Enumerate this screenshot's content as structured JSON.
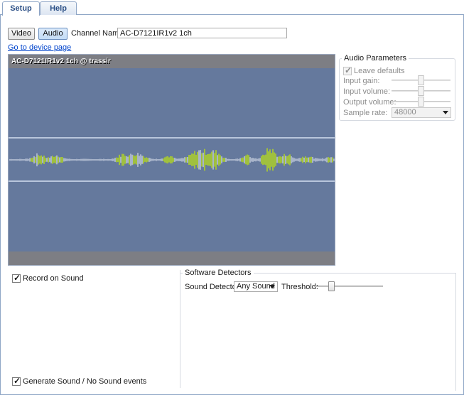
{
  "tabs": [
    {
      "label": "Setup",
      "active": true
    },
    {
      "label": "Help",
      "active": false
    }
  ],
  "toolbar": {
    "video_label": "Video",
    "audio_label": "Audio",
    "channel_name_label": "Channel Name:",
    "channel_name_value": "AC-D7121IR1v2 1ch"
  },
  "device_link": "Go to device page",
  "preview": {
    "title": "AC-D7121IR1v2 1ch @ trassir",
    "waveform_color": "#c8f000",
    "background_color": "#65799d"
  },
  "audio_parameters": {
    "title": "Audio Parameters",
    "leave_defaults_label": "Leave defaults",
    "leave_defaults_checked": true,
    "input_gain_label": "Input gain:",
    "input_gain_level": 0.5,
    "input_volume_label": "Input volume:",
    "input_volume_level": 0.5,
    "output_volume_label": "Output volume:",
    "output_volume_level": 0.5,
    "sample_rate_label": "Sample rate:",
    "sample_rate_value": "48000"
  },
  "record_on_sound": {
    "label": "Record on Sound",
    "checked": true
  },
  "generate_events": {
    "label": "Generate Sound / No Sound events",
    "checked": true
  },
  "software_detectors": {
    "title": "Software Detectors",
    "sound_detector_label": "Sound Detector:",
    "sound_detector_value": "Any Sound",
    "threshold_label": "Threshold:",
    "threshold_level": 0.25
  }
}
